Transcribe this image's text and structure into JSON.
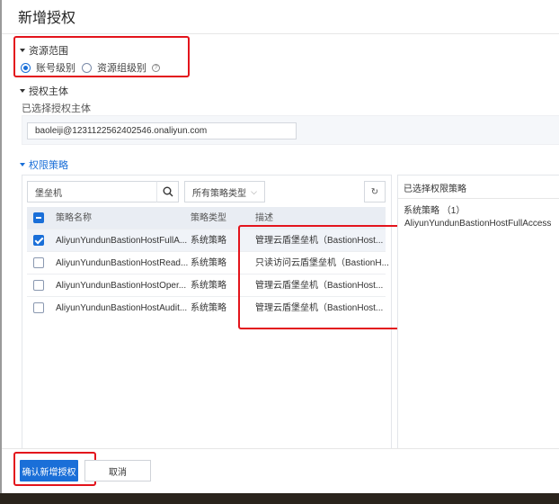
{
  "title": "新增授权",
  "scope": {
    "label": "资源范围",
    "options": [
      "账号级别",
      "资源组级别"
    ],
    "selected": "账号级别"
  },
  "principal": {
    "label": "授权主体",
    "sublabel": "已选择授权主体",
    "value": "baoleiji@1231122562402546.onaliyun.com"
  },
  "policy": {
    "label": "权限策略",
    "search_value": "堡垒机",
    "type_select": "所有策略类型",
    "columns": [
      "策略名称",
      "策略类型",
      "描述"
    ],
    "rows": [
      {
        "name": "AliyunYundunBastionHostFullA...",
        "type": "系统策略",
        "desc": "管理云盾堡垒机（BastionHost...",
        "checked": true
      },
      {
        "name": "AliyunYundunBastionHostRead...",
        "type": "系统策略",
        "desc": "只读访问云盾堡垒机（BastionH...",
        "checked": false
      },
      {
        "name": "AliyunYundunBastionHostOper...",
        "type": "系统策略",
        "desc": "管理云盾堡垒机（BastionHost...",
        "checked": false
      },
      {
        "name": "AliyunYundunBastionHostAudit...",
        "type": "系统策略",
        "desc": "管理云盾堡垒机（BastionHost...",
        "checked": false
      }
    ]
  },
  "selected": {
    "title": "已选择权限策略",
    "group": "系统策略 （1）",
    "items": [
      "AliyunYundunBastionHostFullAccess"
    ]
  },
  "footer": {
    "confirm": "确认新增授权",
    "cancel": "取消"
  },
  "colors": {
    "accent": "#1a6fd8",
    "highlight": "#e3141c"
  }
}
